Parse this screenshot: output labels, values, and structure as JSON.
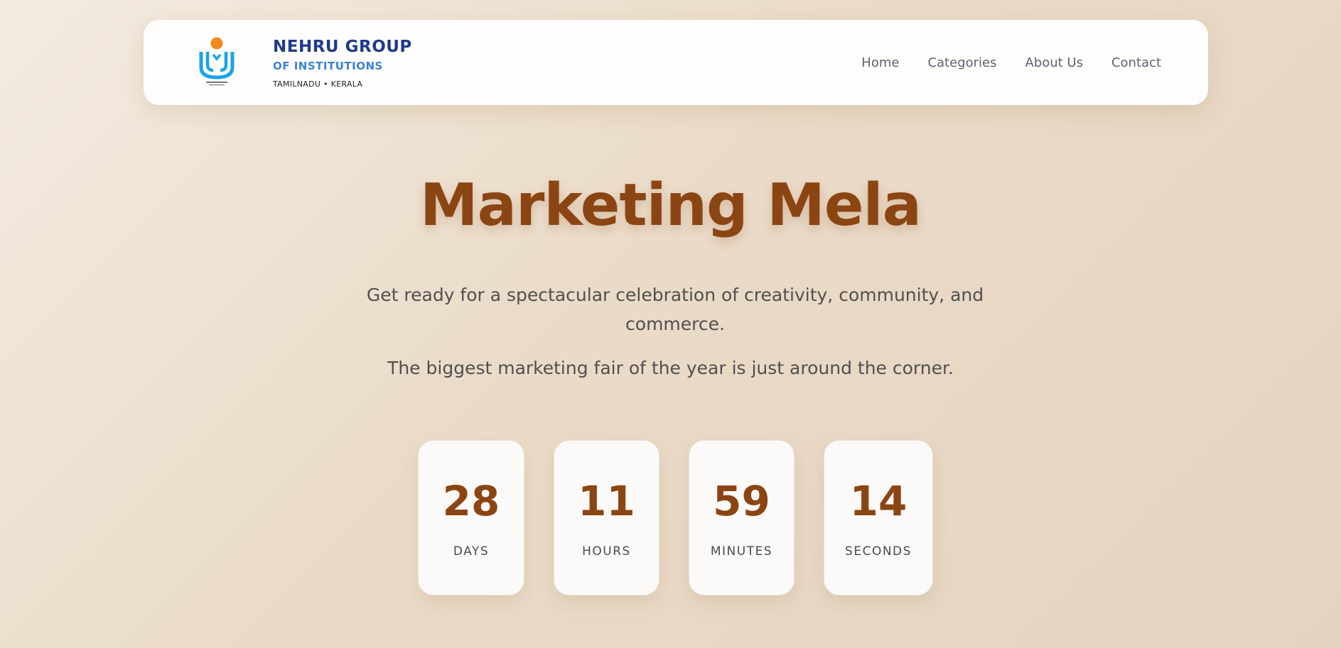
{
  "header": {
    "brand": {
      "title": "NEHRU GROUP",
      "subtitle": "OF INSTITUTIONS",
      "location": "TAMILNADU • KERALA",
      "logo_icon": "nehru-logo-icon",
      "colors": {
        "title": "#1f3a8a",
        "subtitle": "#3b82d6",
        "logo_dot": "#f28a1f",
        "logo_body": "#1aa3e8"
      }
    },
    "nav": [
      {
        "label": "Home"
      },
      {
        "label": "Categories"
      },
      {
        "label": "About Us"
      },
      {
        "label": "Contact"
      }
    ]
  },
  "hero": {
    "title": "Marketing Mela",
    "description": "Get ready for a spectacular celebration of creativity, community, and commerce.",
    "tagline": "The biggest marketing fair of the year is just around the corner.",
    "accent_color": "#8b4513"
  },
  "countdown": [
    {
      "value": "28",
      "label": "DAYS"
    },
    {
      "value": "11",
      "label": "HOURS"
    },
    {
      "value": "59",
      "label": "MINUTES"
    },
    {
      "value": "14",
      "label": "SECONDS"
    }
  ]
}
